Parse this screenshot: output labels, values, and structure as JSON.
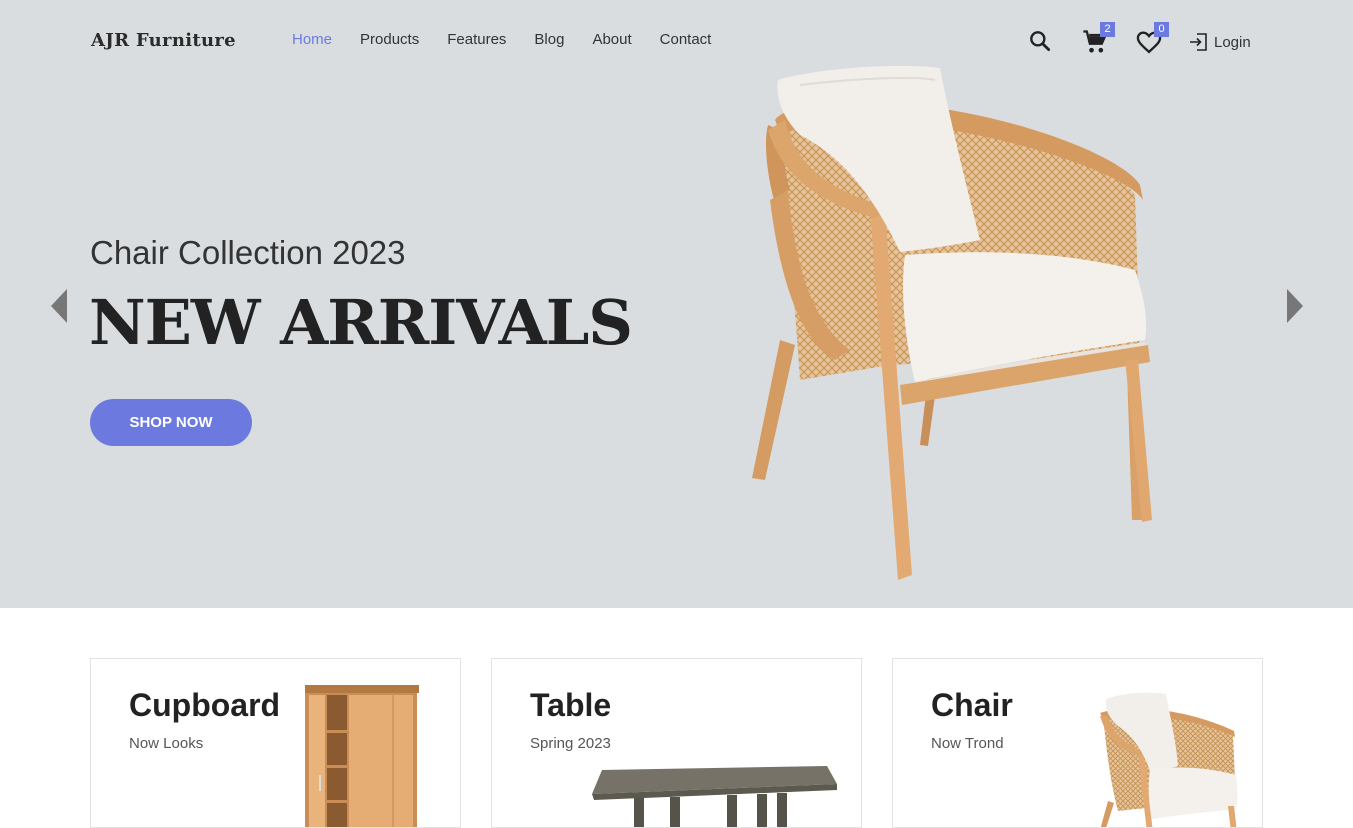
{
  "brand": {
    "logo": "AJR Furniture"
  },
  "nav": {
    "items": [
      {
        "label": "Home",
        "active": true
      },
      {
        "label": "Products",
        "active": false
      },
      {
        "label": "Features",
        "active": false
      },
      {
        "label": "Blog",
        "active": false
      },
      {
        "label": "About",
        "active": false
      },
      {
        "label": "Contact",
        "active": false
      }
    ]
  },
  "header": {
    "cart_count": "2",
    "wishlist_count": "0",
    "login_label": "Login",
    "icons": [
      "search-icon",
      "cart-icon",
      "heart-icon",
      "login-icon"
    ]
  },
  "hero": {
    "subtitle": "Chair Collection 2023",
    "headline": "NEW ARRIVALS",
    "cta_label": "SHOP NOW"
  },
  "categories": [
    {
      "title": "Cupboard",
      "subtitle": "Now Looks"
    },
    {
      "title": "Table",
      "subtitle": "Spring 2023"
    },
    {
      "title": "Chair",
      "subtitle": "Now Trond"
    }
  ],
  "colors": {
    "accent": "#6c7ae0",
    "hero_bg": "#d9dde0",
    "text_dark": "#222222"
  }
}
